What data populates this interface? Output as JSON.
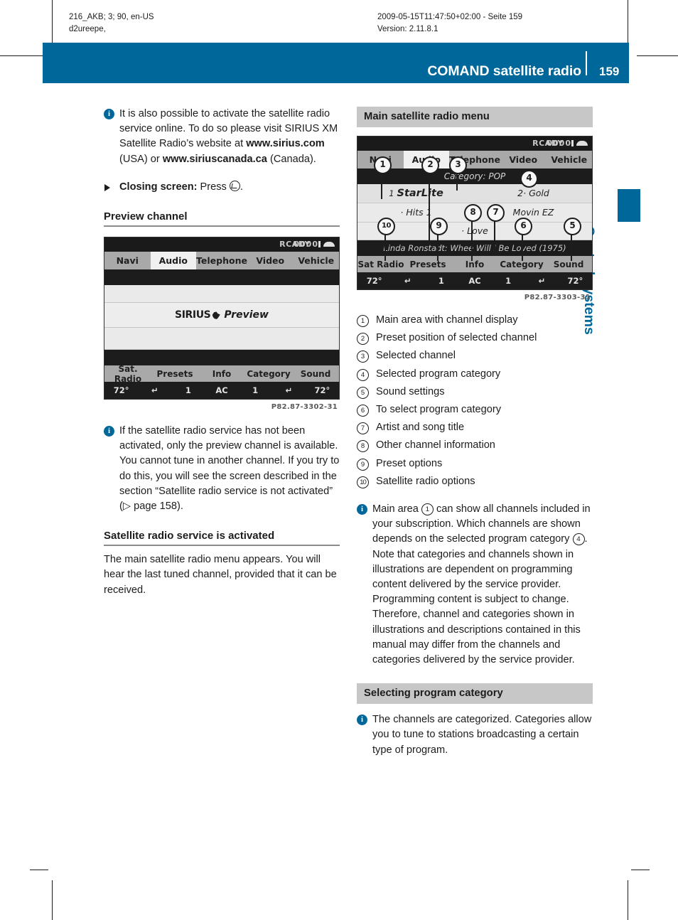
{
  "meta": {
    "left_line1": "216_AKB; 3; 90, en-US",
    "left_line2": "d2ureepe,",
    "right_line1": "2009-05-15T11:47:50+02:00 - Seite 159",
    "right_line2": "Version: 2.11.8.1"
  },
  "header": {
    "title": "COMAND satellite radio",
    "page_number": "159",
    "accent_color": "#00679a"
  },
  "chapter_tab": {
    "label": "Control systems"
  },
  "left_column": {
    "note_online": {
      "text_part1": "It is also possible to activate the satellite radio service online. To do so please visit SIRIUS XM Satellite Radio’s website at ",
      "url_usa": "www.sirius.com",
      "text_part2": " (USA) or ",
      "url_canada": "www.siriuscanada.ca",
      "text_part3": " (Canada)."
    },
    "step_closing": {
      "label": "Closing screen:",
      "text": " Press ",
      "trailing": "."
    },
    "heading_preview": "Preview channel",
    "preview_screen": {
      "status_ready": "RCADY",
      "signal_digits": "0000",
      "menu_items": [
        "Navi",
        "Audio",
        "Telephone",
        "Video",
        "Vehicle"
      ],
      "active_menu_item": "Audio",
      "center_brand": "SIRIUS",
      "center_text": "Preview",
      "softkeys": [
        "Sat. Radio",
        "Presets",
        "Info",
        "Category",
        "Sound"
      ],
      "climate": [
        "72°",
        "↵",
        "1",
        "AC",
        "1",
        "↵",
        "72°"
      ],
      "caption": "P82.87-3302-31"
    },
    "note_not_activated": {
      "text": "If the satellite radio service has not been activated, only the preview channel is available. You cannot tune in another channel. If you try to do this, you will see the screen described in the section “Satellite radio service is not activated” (▷ page 158)."
    },
    "heading_activated": "Satellite radio service is activated",
    "paragraph_activated": "The main satellite radio menu appears. You will hear the last tuned channel, provided that it can be received."
  },
  "right_column": {
    "heading_main_menu": "Main satellite radio menu",
    "main_menu_screen": {
      "status_ready": "RCADY",
      "signal_digits": "0000",
      "menu_items": [
        "Navi",
        "Audio",
        "Telephone",
        "Video",
        "Vehicle"
      ],
      "active_menu_item": "Audio",
      "category_line": "Category: POP",
      "preset_left_num": "1",
      "channel_name": "StarLite",
      "preset_right": "2· Gold",
      "row2_left": "· Hits 1",
      "row2_right": "Movin EZ",
      "row3_center": "· Love",
      "artist_song": "Linda Ronstadt: Whee Will I Be Loved (1975)",
      "softkeys": [
        "Sat Radio",
        "Presets",
        "Info",
        "Category",
        "Sound"
      ],
      "climate": [
        "72°",
        "↵",
        "1",
        "AC",
        "1",
        "↵",
        "72°"
      ],
      "caption": "P82.87-3303-31",
      "callouts": [
        "1",
        "2",
        "3",
        "4",
        "5",
        "6",
        "7",
        "8",
        "9",
        "10"
      ]
    },
    "legend": [
      {
        "num": "1",
        "text": "Main area with channel display"
      },
      {
        "num": "2",
        "text": "Preset position of selected channel"
      },
      {
        "num": "3",
        "text": "Selected channel"
      },
      {
        "num": "4",
        "text": "Selected program category"
      },
      {
        "num": "5",
        "text": "Sound settings"
      },
      {
        "num": "6",
        "text": "To select program category"
      },
      {
        "num": "7",
        "text": "Artist and song title"
      },
      {
        "num": "8",
        "text": "Other channel information"
      },
      {
        "num": "9",
        "text": "Preset options"
      },
      {
        "num": "10",
        "text": "Satellite radio options"
      }
    ],
    "note_main_area": {
      "part1": "Main area ",
      "ref1": "1",
      "part2": " can show all channels included in your subscription. Which channels are shown depends on the selected program category ",
      "ref2": "4",
      "part3": ".",
      "para2": "Note that categories and channels shown in illustrations are dependent on programming content delivered by the service provider. Programming content is subject to change.",
      "para3": "Therefore, channel and categories shown in illustrations and descriptions contained in this manual may differ from the channels and categories delivered by the service provider."
    },
    "heading_selecting_category": "Selecting program category",
    "note_categories": "The channels are categorized. Categories allow you to tune to stations broadcasting a certain type of program."
  }
}
